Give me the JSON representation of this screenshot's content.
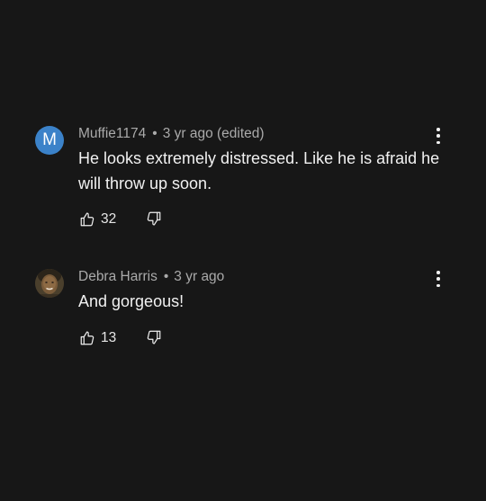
{
  "comments": [
    {
      "author": "Muffie1174",
      "separator": "•",
      "time": "3 yr ago (edited)",
      "text": "He looks extremely distressed. Like he is afraid he will throw up soon.",
      "likes": "32",
      "avatar": {
        "letter": "M",
        "color": "#3b82c9"
      }
    },
    {
      "author": "Debra Harris",
      "separator": "•",
      "time": "3 yr ago",
      "text": "And gorgeous!",
      "likes": "13",
      "avatar": {
        "type": "photo"
      }
    }
  ],
  "icons": {
    "like": "thumb-up-icon",
    "dislike": "thumb-down-icon",
    "more": "more-vertical-icon"
  },
  "colors": {
    "background": "#171717",
    "text": "#f1f1f1",
    "meta": "#aaaaaa"
  }
}
